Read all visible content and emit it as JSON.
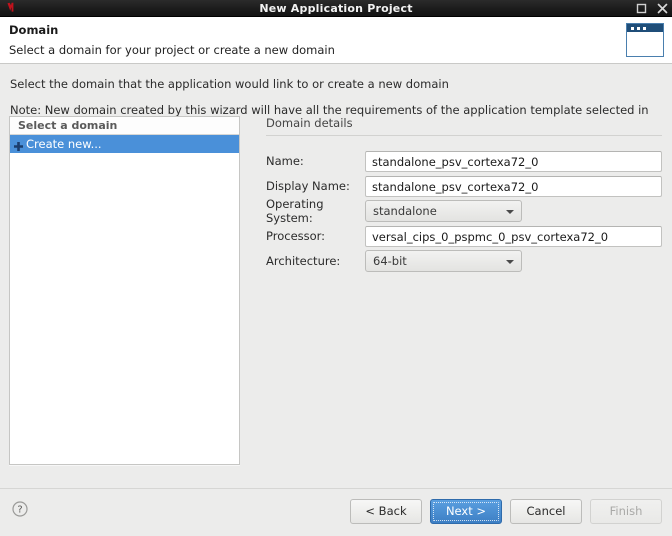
{
  "titlebar": {
    "title": "New Application Project",
    "app_icon": "vitis-logo-icon",
    "maximize_icon": "maximize-icon",
    "close_icon": "close-icon"
  },
  "header": {
    "title": "Domain",
    "subtitle": "Select a domain for your project or create a new domain",
    "banner_icon": "wizard-window-banner-icon"
  },
  "intro": {
    "line1": "Select the domain that the application would link to or create a new domain",
    "line2": "Note: New domain created by this wizard will have all the requirements of the application template selected in the next step"
  },
  "domain_list": {
    "header": "Select a domain",
    "items": [
      {
        "label": "Create new...",
        "icon": "plus-icon",
        "selected": true
      }
    ]
  },
  "details": {
    "title": "Domain details",
    "fields": [
      {
        "label": "Name:",
        "value": "standalone_psv_cortexa72_0",
        "type": "text"
      },
      {
        "label": "Display Name:",
        "value": "standalone_psv_cortexa72_0",
        "type": "text"
      },
      {
        "label": "Operating System:",
        "value": "standalone",
        "type": "combo"
      },
      {
        "label": "Processor:",
        "value": "versal_cips_0_pspmc_0_psv_cortexa72_0",
        "type": "text"
      },
      {
        "label": "Architecture:",
        "value": "64-bit",
        "type": "combo"
      }
    ]
  },
  "footer": {
    "help_icon": "help-question-icon",
    "buttons": {
      "back": "< Back",
      "next": "Next >",
      "cancel": "Cancel",
      "finish": "Finish"
    }
  },
  "colors": {
    "selection_blue": "#4a90d9",
    "primary_button_blue": "#3d7fc4",
    "titlebar_dark": "#1c1c1c",
    "body_gray": "#ececeb",
    "app_icon_red": "#c1121c"
  }
}
